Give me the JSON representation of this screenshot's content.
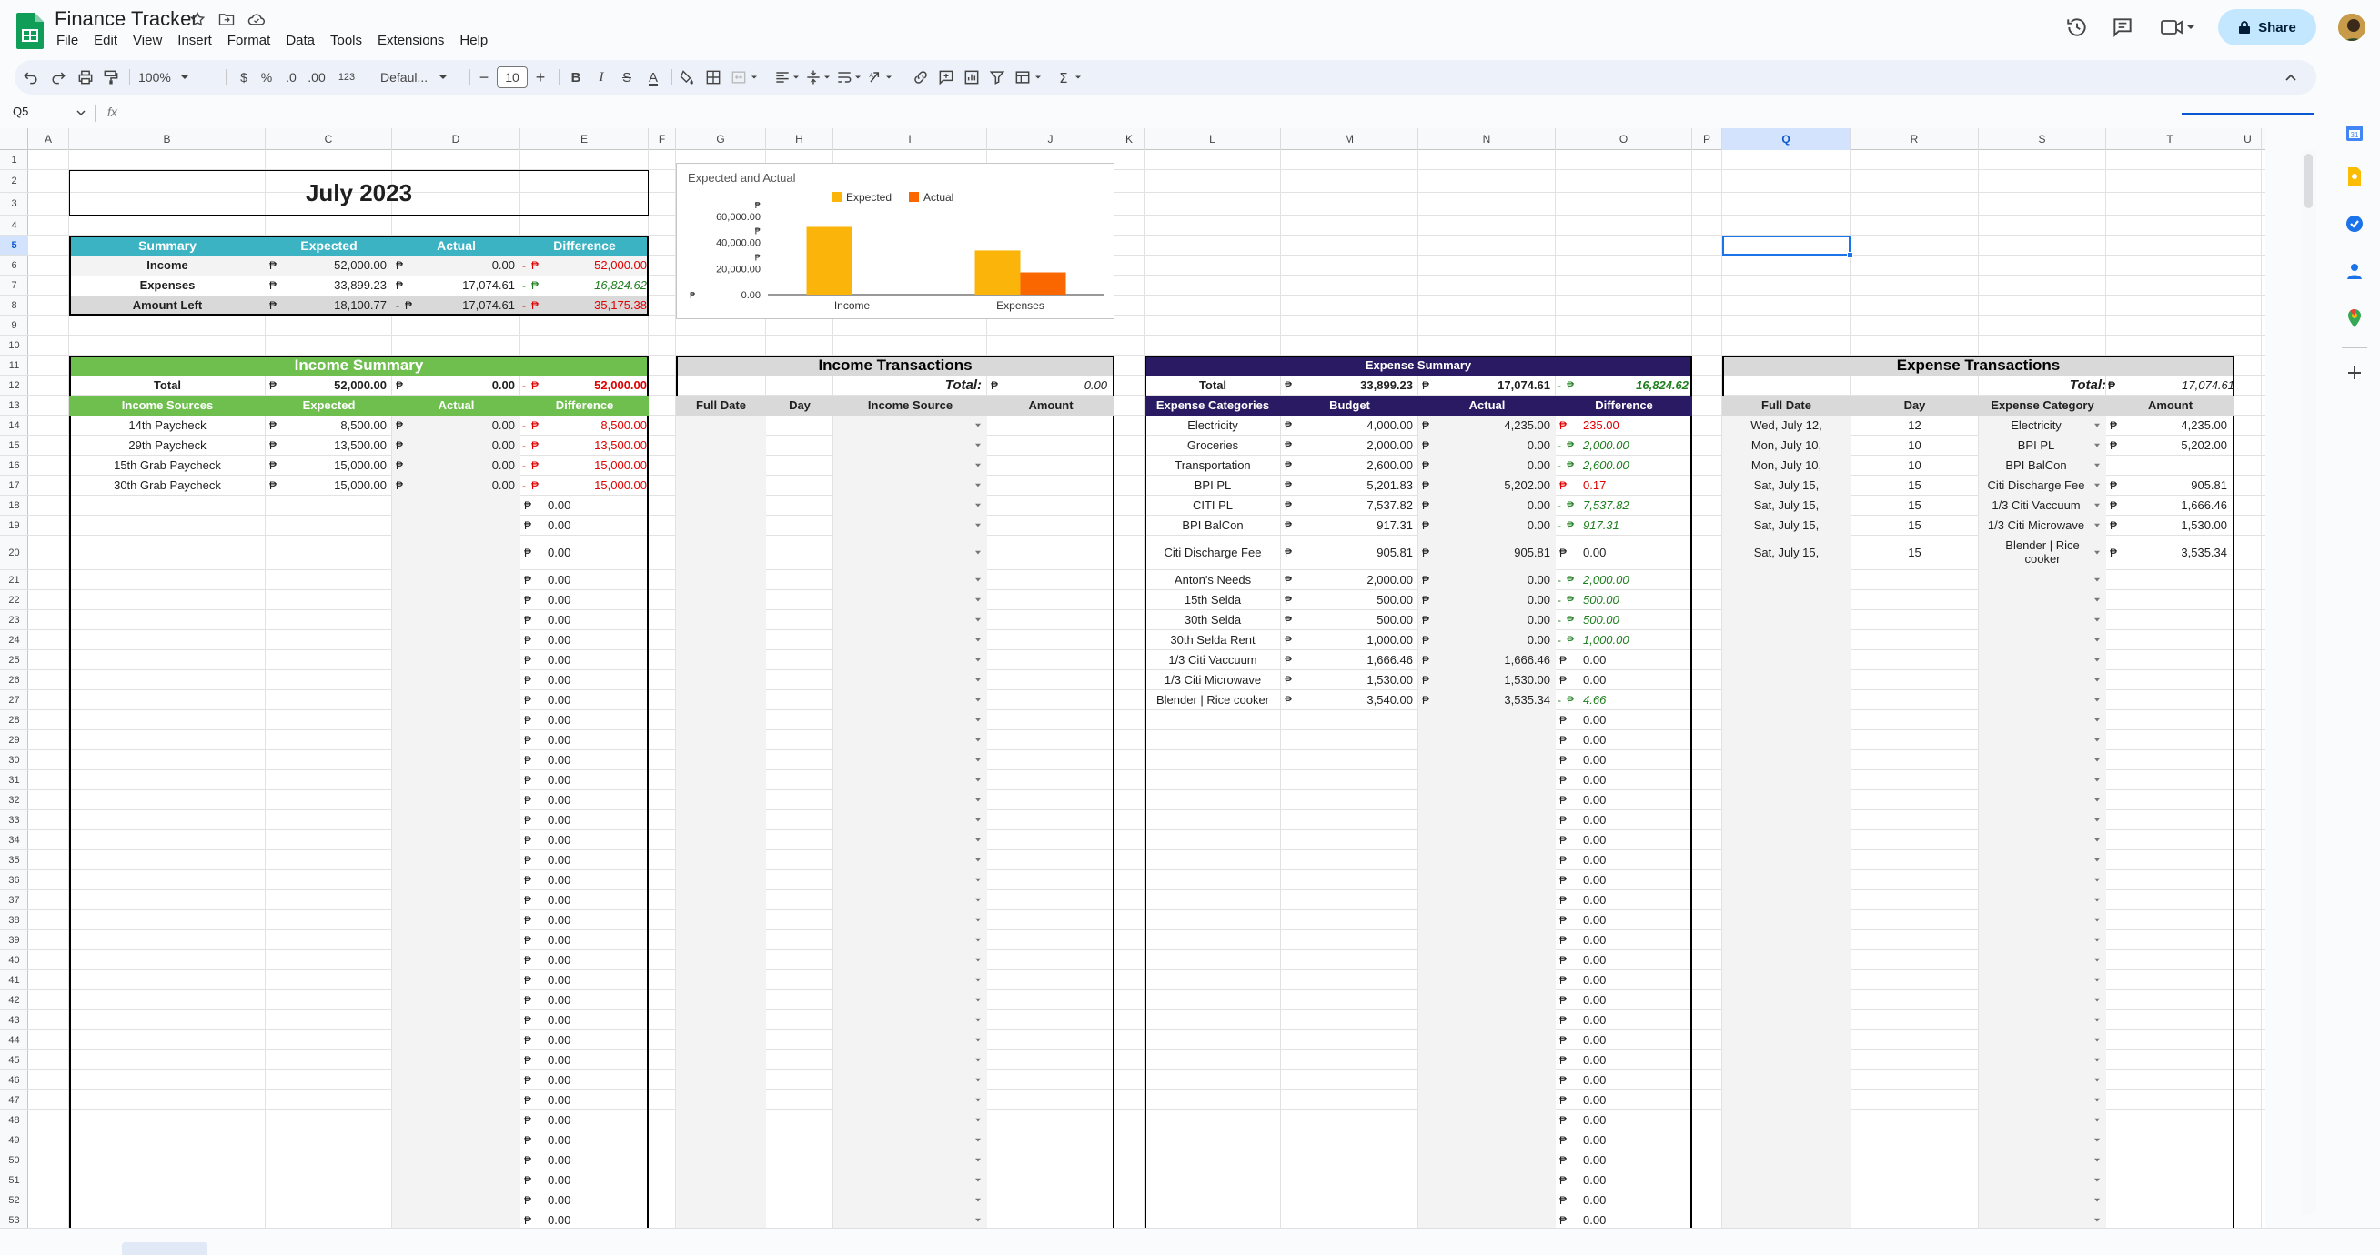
{
  "app": {
    "title": "Finance Tracker",
    "menu": [
      "File",
      "Edit",
      "View",
      "Insert",
      "Format",
      "Data",
      "Tools",
      "Extensions",
      "Help"
    ],
    "share_label": "Share",
    "name_box": "Q5",
    "fx_label": "fx"
  },
  "toolbar": {
    "zoom": "100%",
    "currency": "$",
    "percent": "%",
    "dec_less": ".0",
    "dec_more": ".00",
    "number_format": "123",
    "font": "Defaul...",
    "font_size": "10",
    "bold": "B",
    "italic": "I",
    "strike": "S",
    "text_color": "A",
    "sum": "Σ"
  },
  "columns": [
    {
      "l": "A"
    },
    {
      "l": "B"
    },
    {
      "l": "C"
    },
    {
      "l": "D"
    },
    {
      "l": "E"
    },
    {
      "l": "F"
    },
    {
      "l": "G"
    },
    {
      "l": "H"
    },
    {
      "l": "I"
    },
    {
      "l": "J"
    },
    {
      "l": "K"
    },
    {
      "l": "L"
    },
    {
      "l": "M"
    },
    {
      "l": "N"
    },
    {
      "l": "O"
    },
    {
      "l": "P"
    },
    {
      "l": "Q"
    },
    {
      "l": "R"
    },
    {
      "l": "S"
    },
    {
      "l": "T"
    },
    {
      "l": "U"
    }
  ],
  "rows": [
    "1",
    "2",
    "3",
    "4",
    "5",
    "6",
    "7",
    "8",
    "9",
    "10",
    "11",
    "12",
    "13",
    "14",
    "15",
    "16",
    "17",
    "18",
    "19",
    "20",
    "21",
    "22",
    "23",
    "24",
    "25",
    "26",
    "27",
    "28",
    "29",
    "30",
    "31",
    "32",
    "33",
    "34",
    "35",
    "36",
    "37",
    "38",
    "39",
    "40",
    "41",
    "42",
    "43",
    "44",
    "45",
    "46",
    "47",
    "48",
    "49",
    "50",
    "51",
    "52",
    "53"
  ],
  "month_title": "July 2023",
  "peso": "₱",
  "neg": "-",
  "summary": {
    "headers": [
      "Summary",
      "Expected",
      "Actual",
      "Difference"
    ],
    "rows": [
      {
        "label": "Income",
        "expected": "52,000.00",
        "actual": "0.00",
        "diff": "52,000.00",
        "diff_style": "red",
        "diff_neg": "-",
        "actual_neg": ""
      },
      {
        "label": "Expenses",
        "expected": "33,899.23",
        "actual": "17,074.61",
        "diff": "16,824.62",
        "diff_style": "grn",
        "diff_neg": "-",
        "actual_neg": ""
      },
      {
        "label": "Amount Left",
        "expected": "18,100.77",
        "actual": "17,074.61",
        "diff": "35,175.38",
        "diff_style": "red",
        "diff_neg": "-",
        "actual_neg": "-"
      }
    ]
  },
  "income_summary": {
    "title": "Income Summary",
    "total_label": "Total",
    "total_expected": "52,000.00",
    "total_actual": "0.00",
    "total_diff": "52,000.00",
    "headers": [
      "Income Sources",
      "Expected",
      "Actual",
      "Difference"
    ],
    "rows": [
      {
        "source": "14th Paycheck",
        "expected": "8,500.00",
        "actual": "0.00",
        "diff": "8,500.00"
      },
      {
        "source": "29th Paycheck",
        "expected": "13,500.00",
        "actual": "0.00",
        "diff": "13,500.00"
      },
      {
        "source": "15th Grab Paycheck",
        "expected": "15,000.00",
        "actual": "0.00",
        "diff": "15,000.00"
      },
      {
        "source": "30th Grab Paycheck",
        "expected": "15,000.00",
        "actual": "0.00",
        "diff": "15,000.00"
      }
    ],
    "zero": "0.00"
  },
  "income_tx": {
    "title": "Income Transactions",
    "total_label": "Total:",
    "total_value": "0.00",
    "headers": [
      "Full Date",
      "Day",
      "Income Source",
      "Amount"
    ]
  },
  "expense_summary": {
    "title": "Expense Summary",
    "total_label": "Total",
    "total_budget": "33,899.23",
    "total_actual": "17,074.61",
    "total_diff": "16,824.62",
    "headers": [
      "Expense Categories",
      "Budget",
      "Actual",
      "Difference"
    ],
    "rows": [
      {
        "cat": "Electricity",
        "budget": "4,000.00",
        "actual": "4,235.00",
        "diff": "235.00",
        "style": "red",
        "neg": ""
      },
      {
        "cat": "Groceries",
        "budget": "2,000.00",
        "actual": "0.00",
        "diff": "2,000.00",
        "style": "grn",
        "neg": "-"
      },
      {
        "cat": "Transportation",
        "budget": "2,600.00",
        "actual": "0.00",
        "diff": "2,600.00",
        "style": "grn",
        "neg": "-"
      },
      {
        "cat": "BPI PL",
        "budget": "5,201.83",
        "actual": "5,202.00",
        "diff": "0.17",
        "style": "red",
        "neg": ""
      },
      {
        "cat": "CITI PL",
        "budget": "7,537.82",
        "actual": "0.00",
        "diff": "7,537.82",
        "style": "grn",
        "neg": "-"
      },
      {
        "cat": "BPI BalCon",
        "budget": "917.31",
        "actual": "0.00",
        "diff": "917.31",
        "style": "grn",
        "neg": "-"
      },
      {
        "cat": "Citi Discharge Fee",
        "budget": "905.81",
        "actual": "905.81",
        "diff": "0.00",
        "style": "plain",
        "neg": ""
      },
      {
        "cat": "Anton's Needs",
        "budget": "2,000.00",
        "actual": "0.00",
        "diff": "2,000.00",
        "style": "grn",
        "neg": "-"
      },
      {
        "cat": "15th Selda",
        "budget": "500.00",
        "actual": "0.00",
        "diff": "500.00",
        "style": "grn",
        "neg": "-"
      },
      {
        "cat": "30th Selda",
        "budget": "500.00",
        "actual": "0.00",
        "diff": "500.00",
        "style": "grn",
        "neg": "-"
      },
      {
        "cat": "30th Selda Rent",
        "budget": "1,000.00",
        "actual": "0.00",
        "diff": "1,000.00",
        "style": "grn",
        "neg": "-"
      },
      {
        "cat": "1/3 Citi Vaccuum",
        "budget": "1,666.46",
        "actual": "1,666.46",
        "diff": "0.00",
        "style": "plain",
        "neg": ""
      },
      {
        "cat": "1/3 Citi Microwave",
        "budget": "1,530.00",
        "actual": "1,530.00",
        "diff": "0.00",
        "style": "plain",
        "neg": ""
      },
      {
        "cat": "Blender | Rice cooker",
        "budget": "3,540.00",
        "actual": "3,535.34",
        "diff": "4.66",
        "style": "grn",
        "neg": "-"
      }
    ]
  },
  "expense_tx": {
    "title": "Expense Transactions",
    "total_label": "Total:",
    "total_value": "17,074.61",
    "headers": [
      "Full Date",
      "Day",
      "Expense Category",
      "Amount"
    ],
    "rows": [
      {
        "date": "Wed, July 12,",
        "day": "12",
        "cat": "Electricity",
        "amount": "4,235.00",
        "peso": "₱"
      },
      {
        "date": "Mon, July 10,",
        "day": "10",
        "cat": "BPI PL",
        "amount": "5,202.00",
        "peso": "₱"
      },
      {
        "date": "Mon, July 10,",
        "day": "10",
        "cat": "BPI BalCon",
        "amount": "",
        "peso": ""
      },
      {
        "date": "Sat, July 15,",
        "day": "15",
        "cat": "Citi Discharge Fee",
        "amount": "905.81",
        "peso": "₱"
      },
      {
        "date": "Sat, July 15,",
        "day": "15",
        "cat": "1/3 Citi Vaccuum",
        "amount": "1,666.46",
        "peso": "₱"
      },
      {
        "date": "Sat, July 15,",
        "day": "15",
        "cat": "1/3 Citi Microwave",
        "amount": "1,530.00",
        "peso": "₱"
      },
      {
        "date": "Sat, July 15,",
        "day": "15",
        "cat": "Blender | Rice cooker",
        "amount": "3,535.34",
        "peso": "₱"
      }
    ]
  },
  "colors": {
    "teal": "#3bb3c3",
    "green": "#6fbf4f",
    "purple": "#2a1a63",
    "gray_hdr": "#d9d9d9",
    "expected": "#fbb40a",
    "actual": "#fa6600"
  },
  "chart_data": {
    "type": "bar",
    "title": "Expected and Actual",
    "categories": [
      "Income",
      "Expenses"
    ],
    "series": [
      {
        "name": "Expected",
        "values": [
          52000,
          33899.23
        ]
      },
      {
        "name": "Actual",
        "values": [
          0,
          17074.61
        ]
      }
    ],
    "ylim": [
      0,
      60000
    ],
    "y_ticks": [
      0,
      20000,
      40000,
      60000
    ],
    "y_tick_labels": [
      "0.00",
      "20,000.00",
      "40,000.00",
      "60,000.00"
    ],
    "y_prefix": "₱",
    "legend": "top",
    "grid": false
  }
}
